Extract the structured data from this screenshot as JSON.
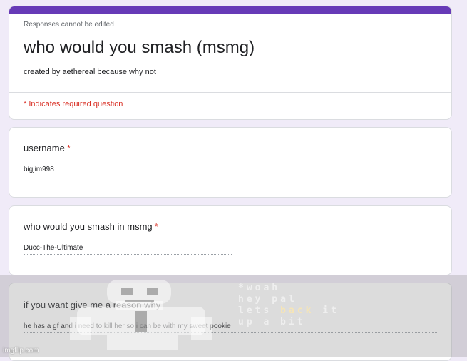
{
  "header": {
    "note": "Responses cannot be edited",
    "title": "who would you smash (msmg)",
    "description": "created by aethereal because why not",
    "required_note": "* Indicates required question"
  },
  "questions": [
    {
      "label": "username",
      "required_mark": "*",
      "answer": "bigjim998"
    },
    {
      "label": "who would you smash in msmg",
      "required_mark": "*",
      "answer": "Ducc-The-Ultimate"
    },
    {
      "label": "if you want give me a reason why",
      "required_mark": "",
      "answer": "he has a gf and i need to kill her so i can be with my sweet pookie"
    }
  ],
  "meme": {
    "line1": "*woah",
    "line2": "hey pal",
    "line3_pre": "lets ",
    "line3_hl": "back",
    "line3_post": " it",
    "line4": "up a bit"
  },
  "watermark": "imgflip.com",
  "colors": {
    "accent": "#673ab7",
    "required": "#d93025",
    "background": "#f0ebf8"
  }
}
